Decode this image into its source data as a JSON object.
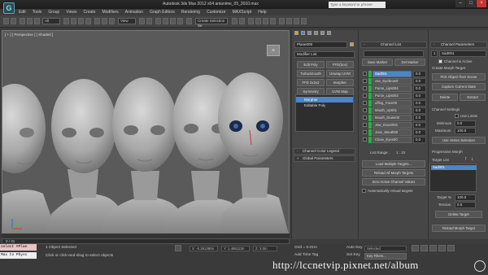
{
  "app": {
    "logo": "G",
    "title": "Autodesk 3ds Max  2012 x64      anianime_05_2010.max",
    "search_placeholder": "Type a keyword or phrase"
  },
  "menus": [
    "Edit",
    "Tools",
    "Group",
    "Views",
    "Create",
    "Modifiers",
    "Animation",
    "Graph Editors",
    "Rendering",
    "Customize",
    "MAXScript",
    "Help"
  ],
  "toolbar": {
    "selection_filter": "All",
    "reference_coord": "View",
    "named_selection": "Create Selection Se"
  },
  "viewport": {
    "label": "[ + ] [ Perspective ] [ Shaded ]",
    "viewcube_label": "☰",
    "time_label": "0 / 31"
  },
  "status": {
    "maxscript_line1": "select #Plan",
    "maxscript_line2": "Max to Physc",
    "selected_text": "1 Object Selected",
    "prompt_text": "Click or click-and-drag to select objects",
    "x": "X: -0.261386n",
    "y": "Y: 1.488123n",
    "z": "Z: 3.0m",
    "grid": "Grid = 0.01m",
    "add_time_tag": "Add Time Tag",
    "auto_key": "Auto Key",
    "set_key": "Set Key",
    "selected_dropdown": "Selected",
    "key_filters": "Key Filters..."
  },
  "modify_panel": {
    "object_name": "Plane009",
    "modifier_list": "Modifier List",
    "buttons": [
      [
        "Edit Poly",
        "FFD(box)"
      ],
      [
        "TurboSmooth",
        "Unwrap UVW"
      ],
      [
        "FFD 2x2x2",
        "Morpher"
      ],
      [
        "Symmetry",
        "UVW Map"
      ]
    ],
    "stack": [
      "Morpher",
      "Editable Poly"
    ],
    "rollouts": [
      "Channel Color Legend",
      "Global Parameters"
    ]
  },
  "channel_list": {
    "header": "Channel List",
    "save_marker": "Save Marker",
    "del_marker": "Del Marker",
    "channels": [
      {
        "name": "Sad001",
        "value": "0.0",
        "active": true,
        "selected": true
      },
      {
        "name": "ose_Eyebrow0",
        "value": "0.0",
        "active": true,
        "selected": false
      },
      {
        "name": "Purse_Lips004",
        "value": "0.0",
        "active": true,
        "selected": false
      },
      {
        "name": "Purse_Lips003",
        "value": "0.0",
        "active": true,
        "selected": false
      },
      {
        "name": "uffing_Face00",
        "value": "0.0",
        "active": true,
        "selected": false
      },
      {
        "name": "Mouth_Up001",
        "value": "0.0",
        "active": true,
        "selected": false
      },
      {
        "name": "Mouth_Down00",
        "value": "0.0",
        "active": true,
        "selected": false
      },
      {
        "name": "Jaw_Down001",
        "value": "0.0",
        "active": true,
        "selected": false
      },
      {
        "name": "Jose_Mouth00",
        "value": "0.0",
        "active": true,
        "selected": false
      },
      {
        "name": "Close_Eyes00",
        "value": "0.0",
        "active": true,
        "selected": false
      }
    ],
    "list_range_label": "List Range :",
    "list_range_value": "1 : 10",
    "load_multiple": "Load Multiple Targets...",
    "reload_all": "Reload All Morph Targets",
    "zero_active": "Zero Active Channel Values",
    "auto_reload": "Automatically reload targets"
  },
  "channel_params": {
    "header": "Channel Parameters",
    "index": "1",
    "name": "Sad001",
    "channel_active": "Channel is Active",
    "create_morph_target": "Create Morph Target",
    "pick_object": "Pick Object from Scene",
    "capture_state": "Capture Current State",
    "delete": "Delete",
    "extract": "Extract",
    "channel_settings": "Channel Settings",
    "use_limits": "Use Limits",
    "minimum_label": "Minimum",
    "minimum_value": "0.0",
    "maximum_label": "Maximum",
    "maximum_value": "100.0",
    "use_vertex_selection": "Use Vertex Selection",
    "progressive_morph": "Progressive Morph",
    "target_list_label": "Target List",
    "targets": [
      "Sad001"
    ],
    "target_pct_label": "Target %",
    "target_pct_value": "100.0",
    "tension_label": "Tension",
    "tension_value": "0.5",
    "delete_target": "Delete Target",
    "reload_morph_target": "Reload Morph Target"
  },
  "watermark": "http://lccnetvip.pixnet.net/album"
}
